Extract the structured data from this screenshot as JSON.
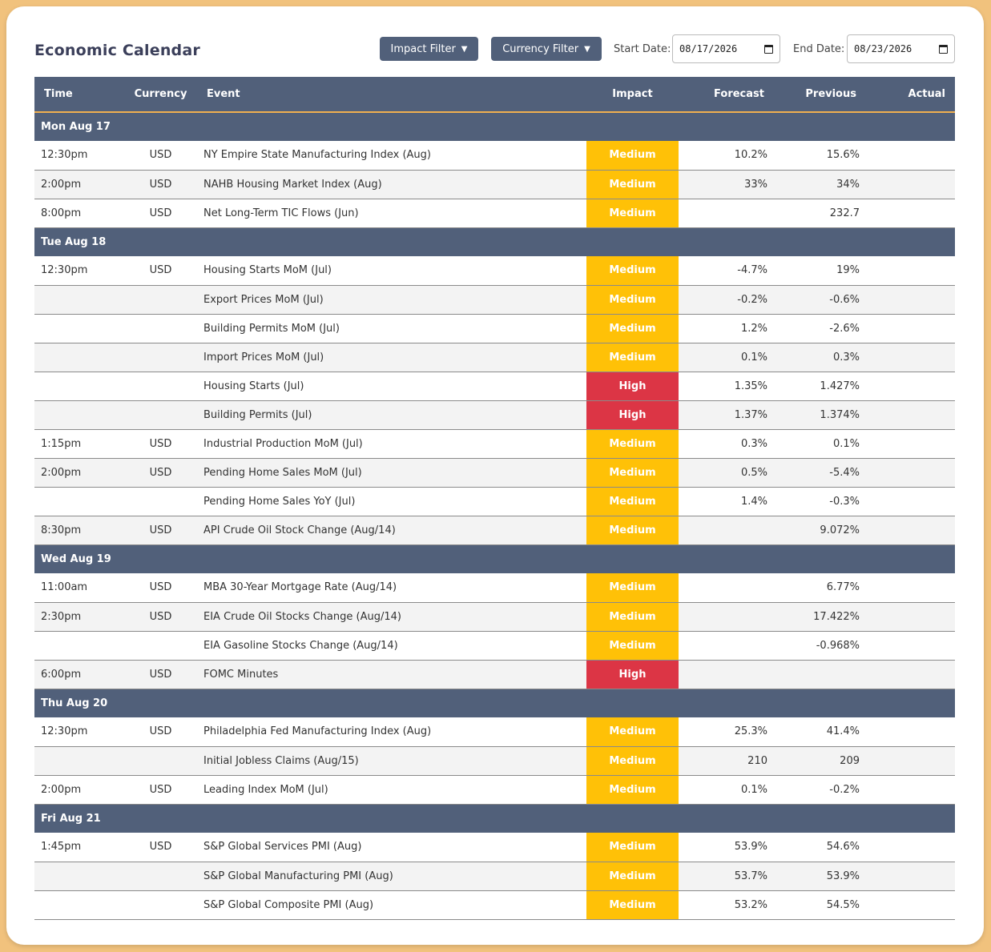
{
  "title": "Economic Calendar",
  "filters": {
    "impact_label": "Impact Filter",
    "currency_label": "Currency Filter",
    "caret": "▼",
    "start_label": "Start Date:",
    "start_value": "08/17/2026",
    "end_label": "End Date:",
    "end_value": "08/23/2026"
  },
  "columns": [
    "Time",
    "Currency",
    "Event",
    "Impact",
    "Forecast",
    "Previous",
    "Actual"
  ],
  "colors": {
    "header": "#51607a",
    "medium": "#ffc107",
    "high": "#dc3545",
    "accent": "#f0b050",
    "background": "#f1c27d"
  },
  "days": [
    {
      "label": "Mon Aug 17",
      "events": [
        {
          "time": "12:30pm",
          "currency": "USD",
          "event": "NY Empire State Manufacturing Index (Aug)",
          "impact": "Medium",
          "forecast": "10.2%",
          "previous": "15.6%",
          "actual": ""
        },
        {
          "time": "2:00pm",
          "currency": "USD",
          "event": "NAHB Housing Market Index (Aug)",
          "impact": "Medium",
          "forecast": "33%",
          "previous": "34%",
          "actual": ""
        },
        {
          "time": "8:00pm",
          "currency": "USD",
          "event": "Net Long-Term TIC Flows (Jun)",
          "impact": "Medium",
          "forecast": "",
          "previous": "232.7",
          "actual": ""
        }
      ]
    },
    {
      "label": "Tue Aug 18",
      "events": [
        {
          "time": "12:30pm",
          "currency": "USD",
          "event": "Housing Starts MoM (Jul)",
          "impact": "Medium",
          "forecast": "-4.7%",
          "previous": "19%",
          "actual": ""
        },
        {
          "time": "",
          "currency": "",
          "event": "Export Prices MoM (Jul)",
          "impact": "Medium",
          "forecast": "-0.2%",
          "previous": "-0.6%",
          "actual": ""
        },
        {
          "time": "",
          "currency": "",
          "event": "Building Permits MoM (Jul)",
          "impact": "Medium",
          "forecast": "1.2%",
          "previous": "-2.6%",
          "actual": ""
        },
        {
          "time": "",
          "currency": "",
          "event": "Import Prices MoM (Jul)",
          "impact": "Medium",
          "forecast": "0.1%",
          "previous": "0.3%",
          "actual": ""
        },
        {
          "time": "",
          "currency": "",
          "event": "Housing Starts (Jul)",
          "impact": "High",
          "forecast": "1.35%",
          "previous": "1.427%",
          "actual": ""
        },
        {
          "time": "",
          "currency": "",
          "event": "Building Permits (Jul)",
          "impact": "High",
          "forecast": "1.37%",
          "previous": "1.374%",
          "actual": ""
        },
        {
          "time": "1:15pm",
          "currency": "USD",
          "event": "Industrial Production MoM (Jul)",
          "impact": "Medium",
          "forecast": "0.3%",
          "previous": "0.1%",
          "actual": ""
        },
        {
          "time": "2:00pm",
          "currency": "USD",
          "event": "Pending Home Sales MoM (Jul)",
          "impact": "Medium",
          "forecast": "0.5%",
          "previous": "-5.4%",
          "actual": ""
        },
        {
          "time": "",
          "currency": "",
          "event": "Pending Home Sales YoY (Jul)",
          "impact": "Medium",
          "forecast": "1.4%",
          "previous": "-0.3%",
          "actual": ""
        },
        {
          "time": "8:30pm",
          "currency": "USD",
          "event": "API Crude Oil Stock Change (Aug/14)",
          "impact": "Medium",
          "forecast": "",
          "previous": "9.072%",
          "actual": ""
        }
      ]
    },
    {
      "label": "Wed Aug 19",
      "events": [
        {
          "time": "11:00am",
          "currency": "USD",
          "event": "MBA 30-Year Mortgage Rate (Aug/14)",
          "impact": "Medium",
          "forecast": "",
          "previous": "6.77%",
          "actual": ""
        },
        {
          "time": "2:30pm",
          "currency": "USD",
          "event": "EIA Crude Oil Stocks Change (Aug/14)",
          "impact": "Medium",
          "forecast": "",
          "previous": "17.422%",
          "actual": ""
        },
        {
          "time": "",
          "currency": "",
          "event": "EIA Gasoline Stocks Change (Aug/14)",
          "impact": "Medium",
          "forecast": "",
          "previous": "-0.968%",
          "actual": ""
        },
        {
          "time": "6:00pm",
          "currency": "USD",
          "event": "FOMC Minutes",
          "impact": "High",
          "forecast": "",
          "previous": "",
          "actual": ""
        }
      ]
    },
    {
      "label": "Thu Aug 20",
      "events": [
        {
          "time": "12:30pm",
          "currency": "USD",
          "event": "Philadelphia Fed Manufacturing Index (Aug)",
          "impact": "Medium",
          "forecast": "25.3%",
          "previous": "41.4%",
          "actual": ""
        },
        {
          "time": "",
          "currency": "",
          "event": "Initial Jobless Claims (Aug/15)",
          "impact": "Medium",
          "forecast": "210",
          "previous": "209",
          "actual": ""
        },
        {
          "time": "2:00pm",
          "currency": "USD",
          "event": "Leading Index MoM (Jul)",
          "impact": "Medium",
          "forecast": "0.1%",
          "previous": "-0.2%",
          "actual": ""
        }
      ]
    },
    {
      "label": "Fri Aug 21",
      "events": [
        {
          "time": "1:45pm",
          "currency": "USD",
          "event": "S&P Global Services PMI (Aug)",
          "impact": "Medium",
          "forecast": "53.9%",
          "previous": "54.6%",
          "actual": ""
        },
        {
          "time": "",
          "currency": "",
          "event": "S&P Global Manufacturing PMI (Aug)",
          "impact": "Medium",
          "forecast": "53.7%",
          "previous": "53.9%",
          "actual": ""
        },
        {
          "time": "",
          "currency": "",
          "event": "S&P Global Composite PMI (Aug)",
          "impact": "Medium",
          "forecast": "53.2%",
          "previous": "54.5%",
          "actual": ""
        }
      ]
    }
  ]
}
